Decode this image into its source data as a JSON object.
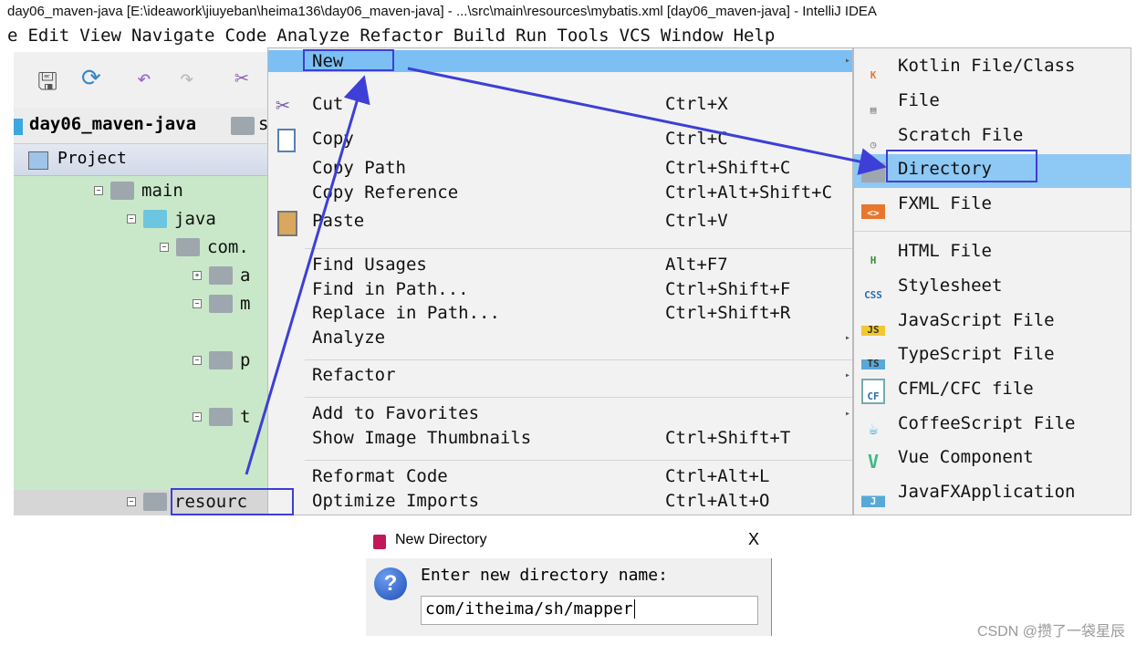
{
  "window": {
    "title": "day06_maven-java [E:\\ideawork\\jiuyeban\\heima136\\day06_maven-java] - ...\\src\\main\\resources\\mybatis.xml [day06_maven-java] - IntelliJ IDEA"
  },
  "menubar": [
    "e",
    "Edit",
    "View",
    "Navigate",
    "Code",
    "Analyze",
    "Refactor",
    "Build",
    "Run",
    "Tools",
    "VCS",
    "Window",
    "Help"
  ],
  "breadcrumb": {
    "project": "day06_maven-java",
    "next": "s"
  },
  "project_panel": {
    "title": "Project"
  },
  "tree": {
    "main": "main",
    "java": "java",
    "com": "com.",
    "a": "a",
    "m": "m",
    "p": "p",
    "t": "t",
    "resources": "resourc"
  },
  "context_menu": {
    "items": [
      {
        "label": "New",
        "shortcut": "",
        "submenu": true
      },
      {
        "label": "Cut",
        "shortcut": "Ctrl+X"
      },
      {
        "label": "Copy",
        "shortcut": "Ctrl+C"
      },
      {
        "label": "Copy Path",
        "shortcut": "Ctrl+Shift+C"
      },
      {
        "label": "Copy Reference",
        "shortcut": "Ctrl+Alt+Shift+C"
      },
      {
        "label": "Paste",
        "shortcut": "Ctrl+V"
      },
      {
        "label": "Find Usages",
        "shortcut": "Alt+F7"
      },
      {
        "label": "Find in Path...",
        "shortcut": "Ctrl+Shift+F"
      },
      {
        "label": "Replace in Path...",
        "shortcut": "Ctrl+Shift+R"
      },
      {
        "label": "Analyze",
        "shortcut": "",
        "submenu": true
      },
      {
        "label": "Refactor",
        "shortcut": "",
        "submenu": true
      },
      {
        "label": "Add to Favorites",
        "shortcut": "",
        "submenu": true
      },
      {
        "label": "Show Image Thumbnails",
        "shortcut": "Ctrl+Shift+T"
      },
      {
        "label": "Reformat Code",
        "shortcut": "Ctrl+Alt+L"
      },
      {
        "label": "Optimize Imports",
        "shortcut": "Ctrl+Alt+O"
      }
    ]
  },
  "new_submenu": {
    "items": [
      {
        "label": "Kotlin File/Class",
        "icon": "K"
      },
      {
        "label": "File",
        "icon": ""
      },
      {
        "label": "Scratch File",
        "icon": ""
      },
      {
        "label": "Directory",
        "icon": ""
      },
      {
        "label": "FXML File",
        "icon": "<>"
      },
      {
        "label": "HTML File",
        "icon": "H"
      },
      {
        "label": "Stylesheet",
        "icon": "CSS"
      },
      {
        "label": "JavaScript File",
        "icon": "JS"
      },
      {
        "label": "TypeScript File",
        "icon": "TS"
      },
      {
        "label": "CFML/CFC file",
        "icon": "CF"
      },
      {
        "label": "CoffeeScript File",
        "icon": ""
      },
      {
        "label": "Vue Component",
        "icon": "V"
      },
      {
        "label": "JavaFXApplication",
        "icon": "J"
      }
    ]
  },
  "dialog": {
    "title": "New Directory",
    "prompt": "Enter new directory name:",
    "value": "com/itheima/sh/mapper",
    "close": "X"
  },
  "watermark": "CSDN @攒了一袋星辰",
  "colors": {
    "highlight": "#7cbff5",
    "annotation": "#3d3fd6",
    "tree_bg": "#c9e8c9"
  }
}
